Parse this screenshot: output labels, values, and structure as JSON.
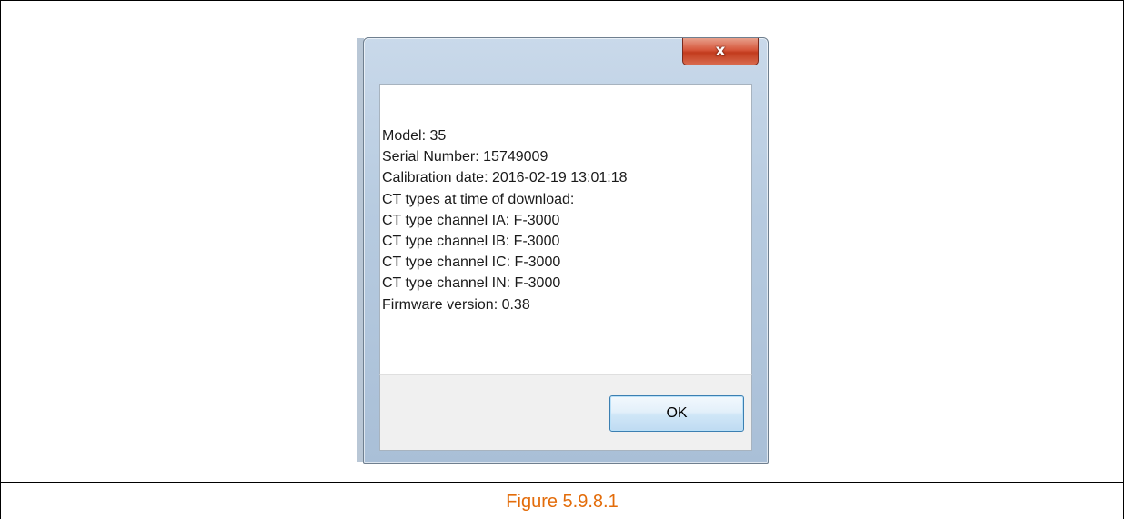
{
  "dialog": {
    "close_glyph": "x",
    "lines": [
      "Model: 35",
      "Serial Number: 15749009",
      "Calibration date: 2016-02-19 13:01:18",
      "CT types at time of download:",
      "CT type channel IA: F-3000",
      "CT type channel IB: F-3000",
      "CT type channel IC: F-3000",
      "CT type channel IN: F-3000",
      "Firmware version: 0.38"
    ],
    "ok_label": "OK"
  },
  "caption": "Figure 5.9.8.1",
  "colors": {
    "caption": "#e36c0a",
    "close_button": "#c23b1d",
    "ok_border": "#3c7fb1"
  },
  "icons": {
    "close": "close-icon"
  }
}
